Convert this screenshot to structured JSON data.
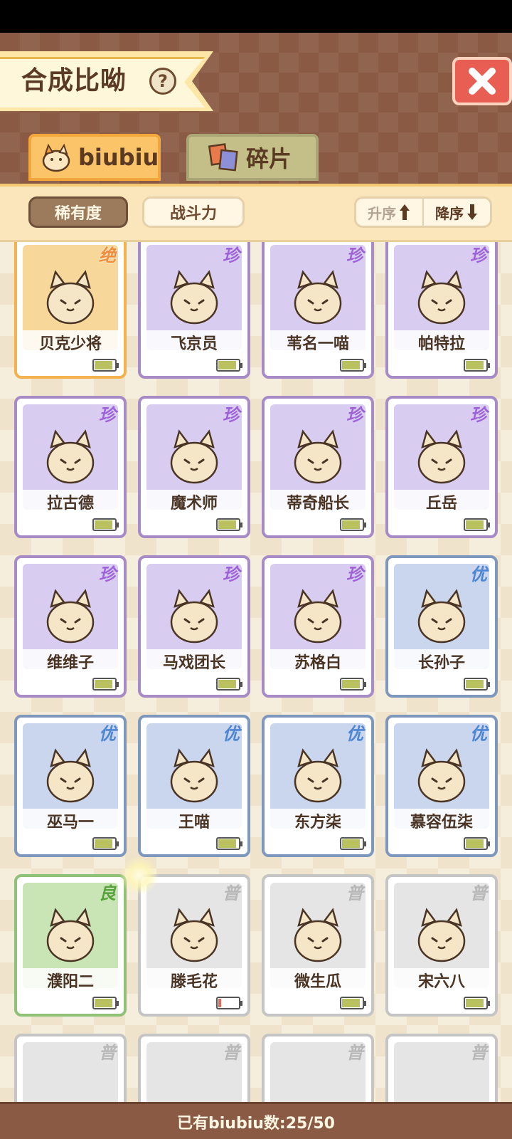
{
  "header": {
    "title": "合成比呦",
    "help_label": "?",
    "close_label": "close"
  },
  "tabs": [
    {
      "label": "biubiu",
      "active": true
    },
    {
      "label": "碎片",
      "active": false
    }
  ],
  "filters": {
    "rarity_label": "稀有度",
    "power_label": "战斗力",
    "sort_asc_label": "升序",
    "sort_desc_label": "降序",
    "active": "稀有度"
  },
  "rarity_badges": {
    "jue": "绝",
    "zhen": "珍",
    "you": "优",
    "liang": "良",
    "pu": "普"
  },
  "cards": [
    {
      "name": "贝克少将",
      "rarity": "jue",
      "battery": 0.9
    },
    {
      "name": "飞京员",
      "rarity": "zhen",
      "battery": 0.9
    },
    {
      "name": "苇名一喵",
      "rarity": "zhen",
      "battery": 0.9
    },
    {
      "name": "帕特拉",
      "rarity": "zhen",
      "battery": 0.9
    },
    {
      "name": "拉古德",
      "rarity": "zhen",
      "battery": 0.9
    },
    {
      "name": "魔术师",
      "rarity": "zhen",
      "battery": 0.9
    },
    {
      "name": "蒂奇船长",
      "rarity": "zhen",
      "battery": 0.9
    },
    {
      "name": "丘岳",
      "rarity": "zhen",
      "battery": 0.9
    },
    {
      "name": "维维子",
      "rarity": "zhen",
      "battery": 0.9
    },
    {
      "name": "马戏团长",
      "rarity": "zhen",
      "battery": 0.9
    },
    {
      "name": "苏格白",
      "rarity": "zhen",
      "battery": 0.9
    },
    {
      "name": "长孙子",
      "rarity": "you",
      "battery": 0.9
    },
    {
      "name": "巫马一",
      "rarity": "you",
      "battery": 0.9
    },
    {
      "name": "王喵",
      "rarity": "you",
      "battery": 0.9
    },
    {
      "name": "东方柒",
      "rarity": "you",
      "battery": 0.9
    },
    {
      "name": "慕容伍柒",
      "rarity": "you",
      "battery": 0.9
    },
    {
      "name": "濮阳二",
      "rarity": "liang",
      "battery": 0.9
    },
    {
      "name": "滕毛花",
      "rarity": "pu",
      "battery": 0.15
    },
    {
      "name": "微生瓜",
      "rarity": "pu",
      "battery": 0.9
    },
    {
      "name": "宋六八",
      "rarity": "pu",
      "battery": 0.9
    },
    {
      "name": "",
      "rarity": "pu",
      "battery": null
    },
    {
      "name": "",
      "rarity": "pu",
      "battery": null
    },
    {
      "name": "",
      "rarity": "pu",
      "battery": null
    },
    {
      "name": "",
      "rarity": "pu",
      "battery": null
    }
  ],
  "footer": {
    "count_text": "已有biubiu数:25/50"
  },
  "colors": {
    "header_bg": "#8a5a44",
    "accent_orange": "#fcc468",
    "rarity_jue": "#f08c3a",
    "rarity_zhen": "#9e62d8",
    "rarity_you": "#4e86d3",
    "rarity_liang": "#58a23d",
    "rarity_pu": "#b8b8b8"
  }
}
